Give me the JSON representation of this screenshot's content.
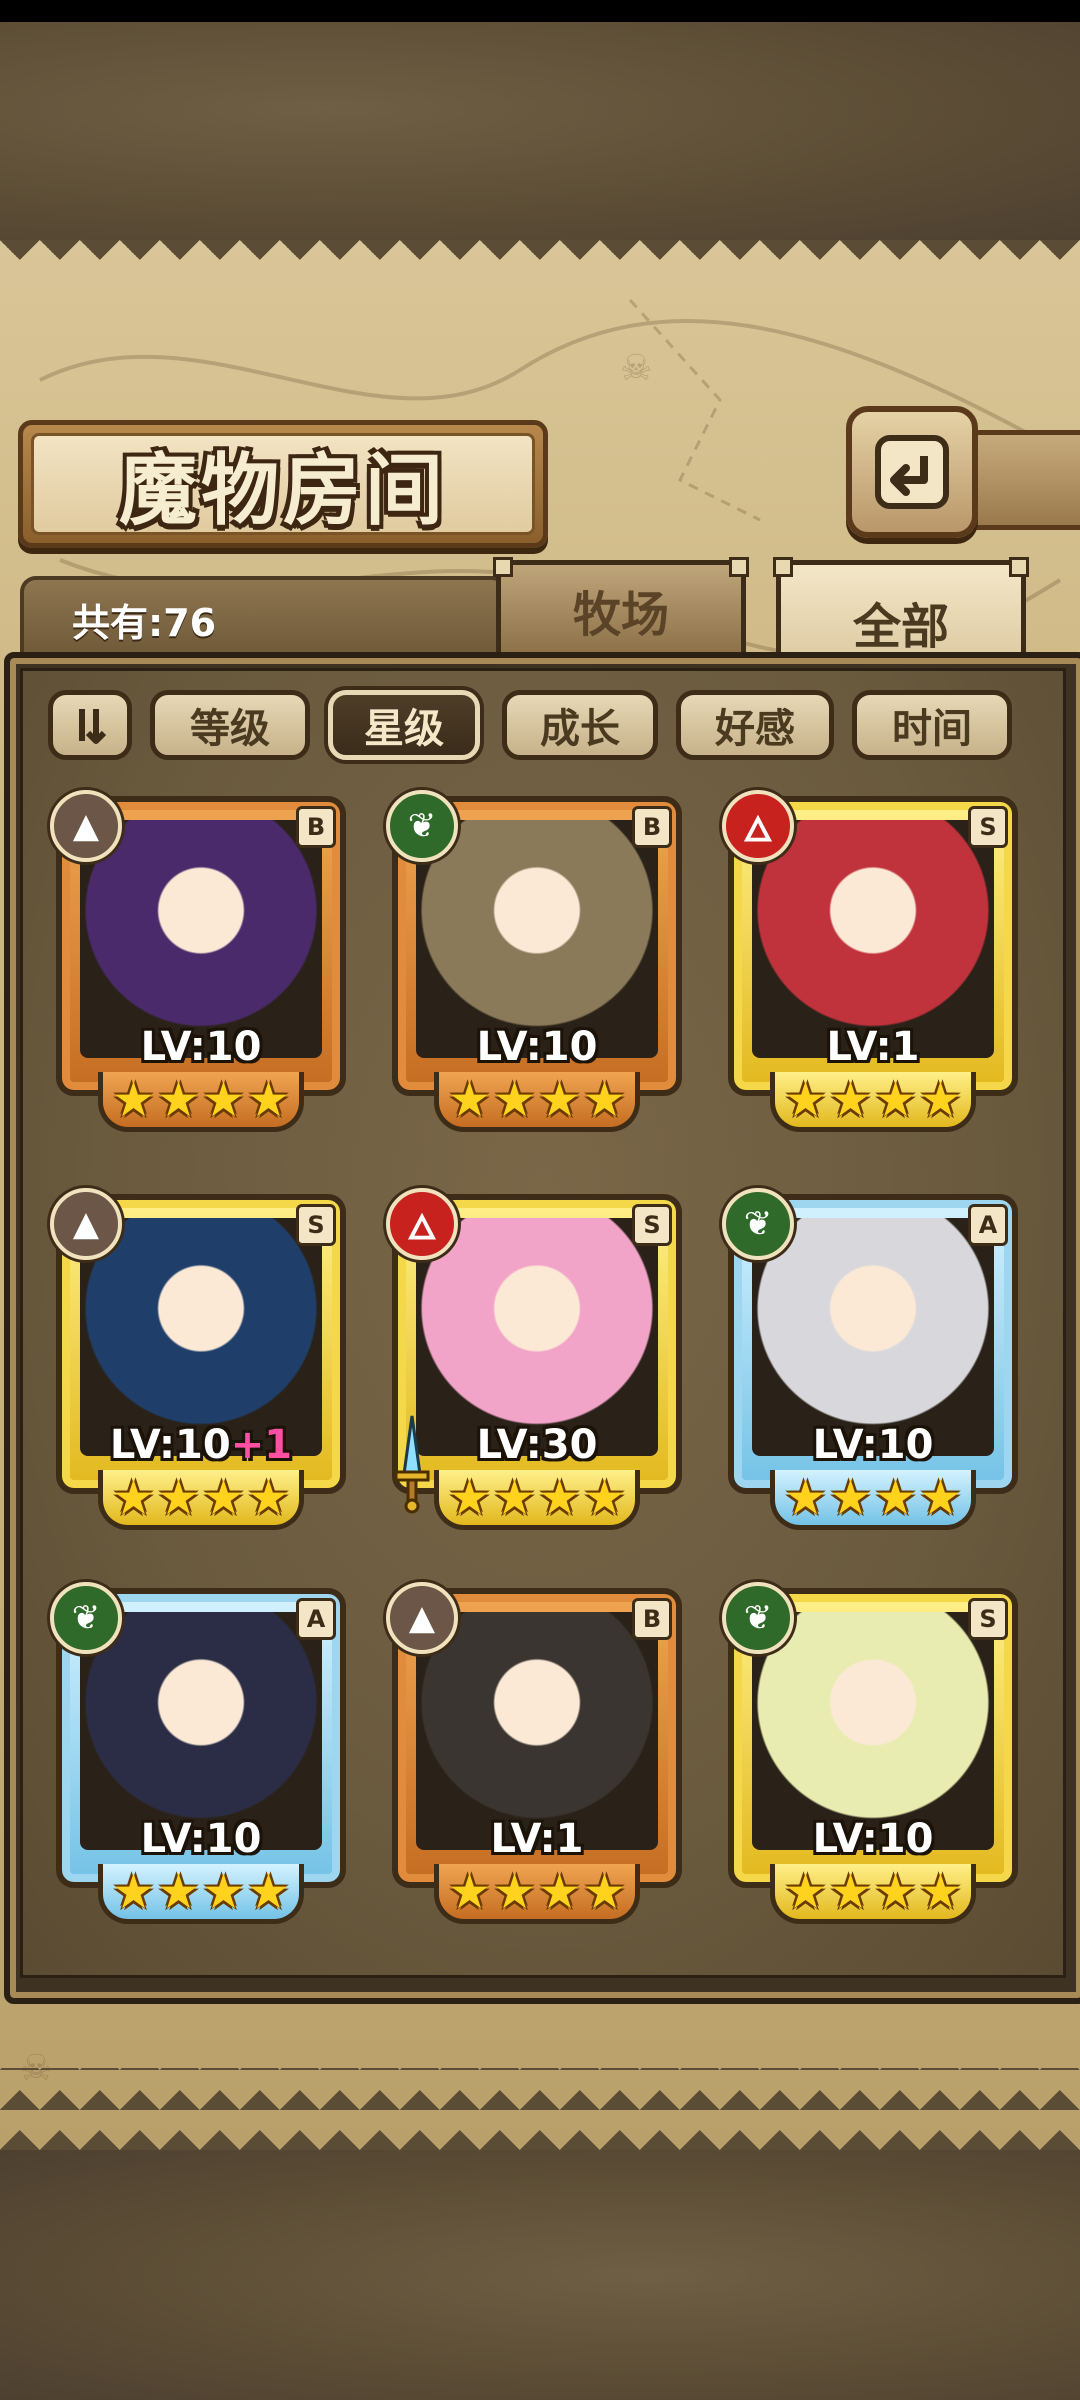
{
  "header": {
    "title": "魔物房间",
    "back_label": "返回"
  },
  "tabs": {
    "count_label": "共有:76",
    "ranch_label": "牧场",
    "all_label": "全部",
    "active": "全部"
  },
  "sort_filters": {
    "toggle_icon": "sort-toggle-icon",
    "items": [
      {
        "label": "等级",
        "active": false
      },
      {
        "label": "星级",
        "active": true
      },
      {
        "label": "成长",
        "active": false
      },
      {
        "label": "好感",
        "active": false
      },
      {
        "label": "时间",
        "active": false
      }
    ]
  },
  "monsters": [
    {
      "name_key": "monster-1",
      "level": "LV:10",
      "bonus": "",
      "rank": "B",
      "element": "earth",
      "frame": "orange",
      "stars": 4,
      "art_color": "#4a2a6b"
    },
    {
      "name_key": "monster-2",
      "level": "LV:10",
      "bonus": "",
      "rank": "B",
      "element": "wood",
      "frame": "orange",
      "stars": 4,
      "art_color": "#8a7a5a"
    },
    {
      "name_key": "monster-3",
      "level": "LV:1",
      "bonus": "",
      "rank": "S",
      "element": "fire",
      "frame": "gold",
      "stars": 4,
      "art_color": "#c0323c"
    },
    {
      "name_key": "monster-4",
      "level": "LV:10",
      "bonus": "+1",
      "rank": "S",
      "element": "earth",
      "frame": "gold",
      "stars": 4,
      "art_color": "#1f3f6a"
    },
    {
      "name_key": "monster-5",
      "level": "LV:30",
      "bonus": "",
      "rank": "S",
      "element": "fire",
      "frame": "gold",
      "stars": 4,
      "art_color": "#f2a3c8"
    },
    {
      "name_key": "monster-6",
      "level": "LV:10",
      "bonus": "",
      "rank": "A",
      "element": "wood",
      "frame": "blue",
      "stars": 4,
      "art_color": "#d8d8dc"
    },
    {
      "name_key": "monster-7",
      "level": "LV:10",
      "bonus": "",
      "rank": "A",
      "element": "wood",
      "frame": "blue",
      "stars": 4,
      "art_color": "#2a2d45"
    },
    {
      "name_key": "monster-8",
      "level": "LV:1",
      "bonus": "",
      "rank": "B",
      "element": "earth",
      "frame": "orange",
      "stars": 4,
      "art_color": "#3a3530"
    },
    {
      "name_key": "monster-9",
      "level": "LV:10",
      "bonus": "",
      "rank": "S",
      "element": "wood",
      "frame": "gold",
      "stars": 4,
      "art_color": "#e8ecb0"
    }
  ],
  "colors": {
    "accent_brown": "#3d2c17",
    "parchment": "#d9c597",
    "star": "#ffd21e",
    "bonus_pink": "#ff4fa3"
  }
}
